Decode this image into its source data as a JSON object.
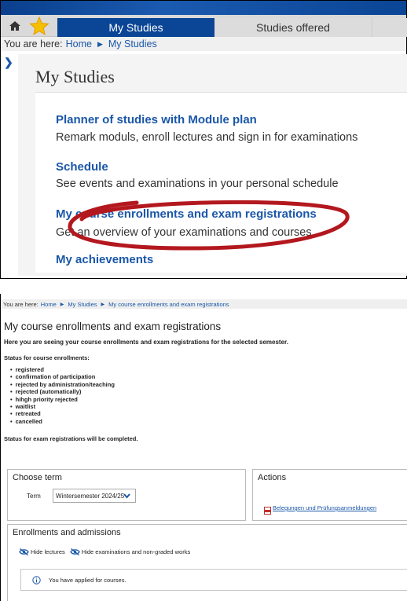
{
  "top": {
    "nav": {
      "tabs": [
        {
          "label": "My Studies"
        },
        {
          "label": "Studies offered"
        }
      ]
    },
    "breadcrumb": {
      "prefix": "You are here:",
      "items": [
        "Home",
        "My Studies"
      ]
    },
    "page_title": "My Studies",
    "menu": [
      {
        "title": "Planner of studies with Module plan",
        "desc": "Remark moduls, enroll lectures and sign in for examinations"
      },
      {
        "title": "Schedule",
        "desc": "See events and examinations in your personal schedule"
      },
      {
        "title": "My course enrollments and exam registrations",
        "desc": "Get an overview of your examinations and courses"
      },
      {
        "title": "My achievements",
        "desc": ""
      }
    ],
    "highlight_color": "#b3181e"
  },
  "bottom": {
    "breadcrumb": {
      "prefix": "You are here:",
      "items": [
        "Home",
        "My Studies",
        "My course enrollments and exam registrations"
      ]
    },
    "page_title": "My course enrollments and exam registrations",
    "intro": "Here you are seeing your course enrollments and exam registrations for the selected semester.",
    "status_heading": "Status for course enrollments:",
    "statuses": [
      "registered",
      "confirmation of participation",
      "rejected by administration/teaching",
      "rejected (automatically)",
      "hihgh priority rejected",
      "waitlist",
      "retreated",
      "cancelled"
    ],
    "exam_note": "Status for exam registrations will be completed.",
    "choose_term": {
      "title": "Choose term",
      "label": "Term",
      "selected": "Wintersemester 2024/25"
    },
    "actions": {
      "title": "Actions",
      "link": "Belegungen und Prüfungsanmeldungen"
    },
    "enrollments": {
      "title": "Enrollments and admissions",
      "hide_lectures": "Hide lectures",
      "hide_exams": "Hide examinations and non-graded works",
      "info": "You have applied for courses."
    }
  },
  "colors": {
    "brand_blue": "#0b4595",
    "link_blue": "#1a57a8"
  }
}
